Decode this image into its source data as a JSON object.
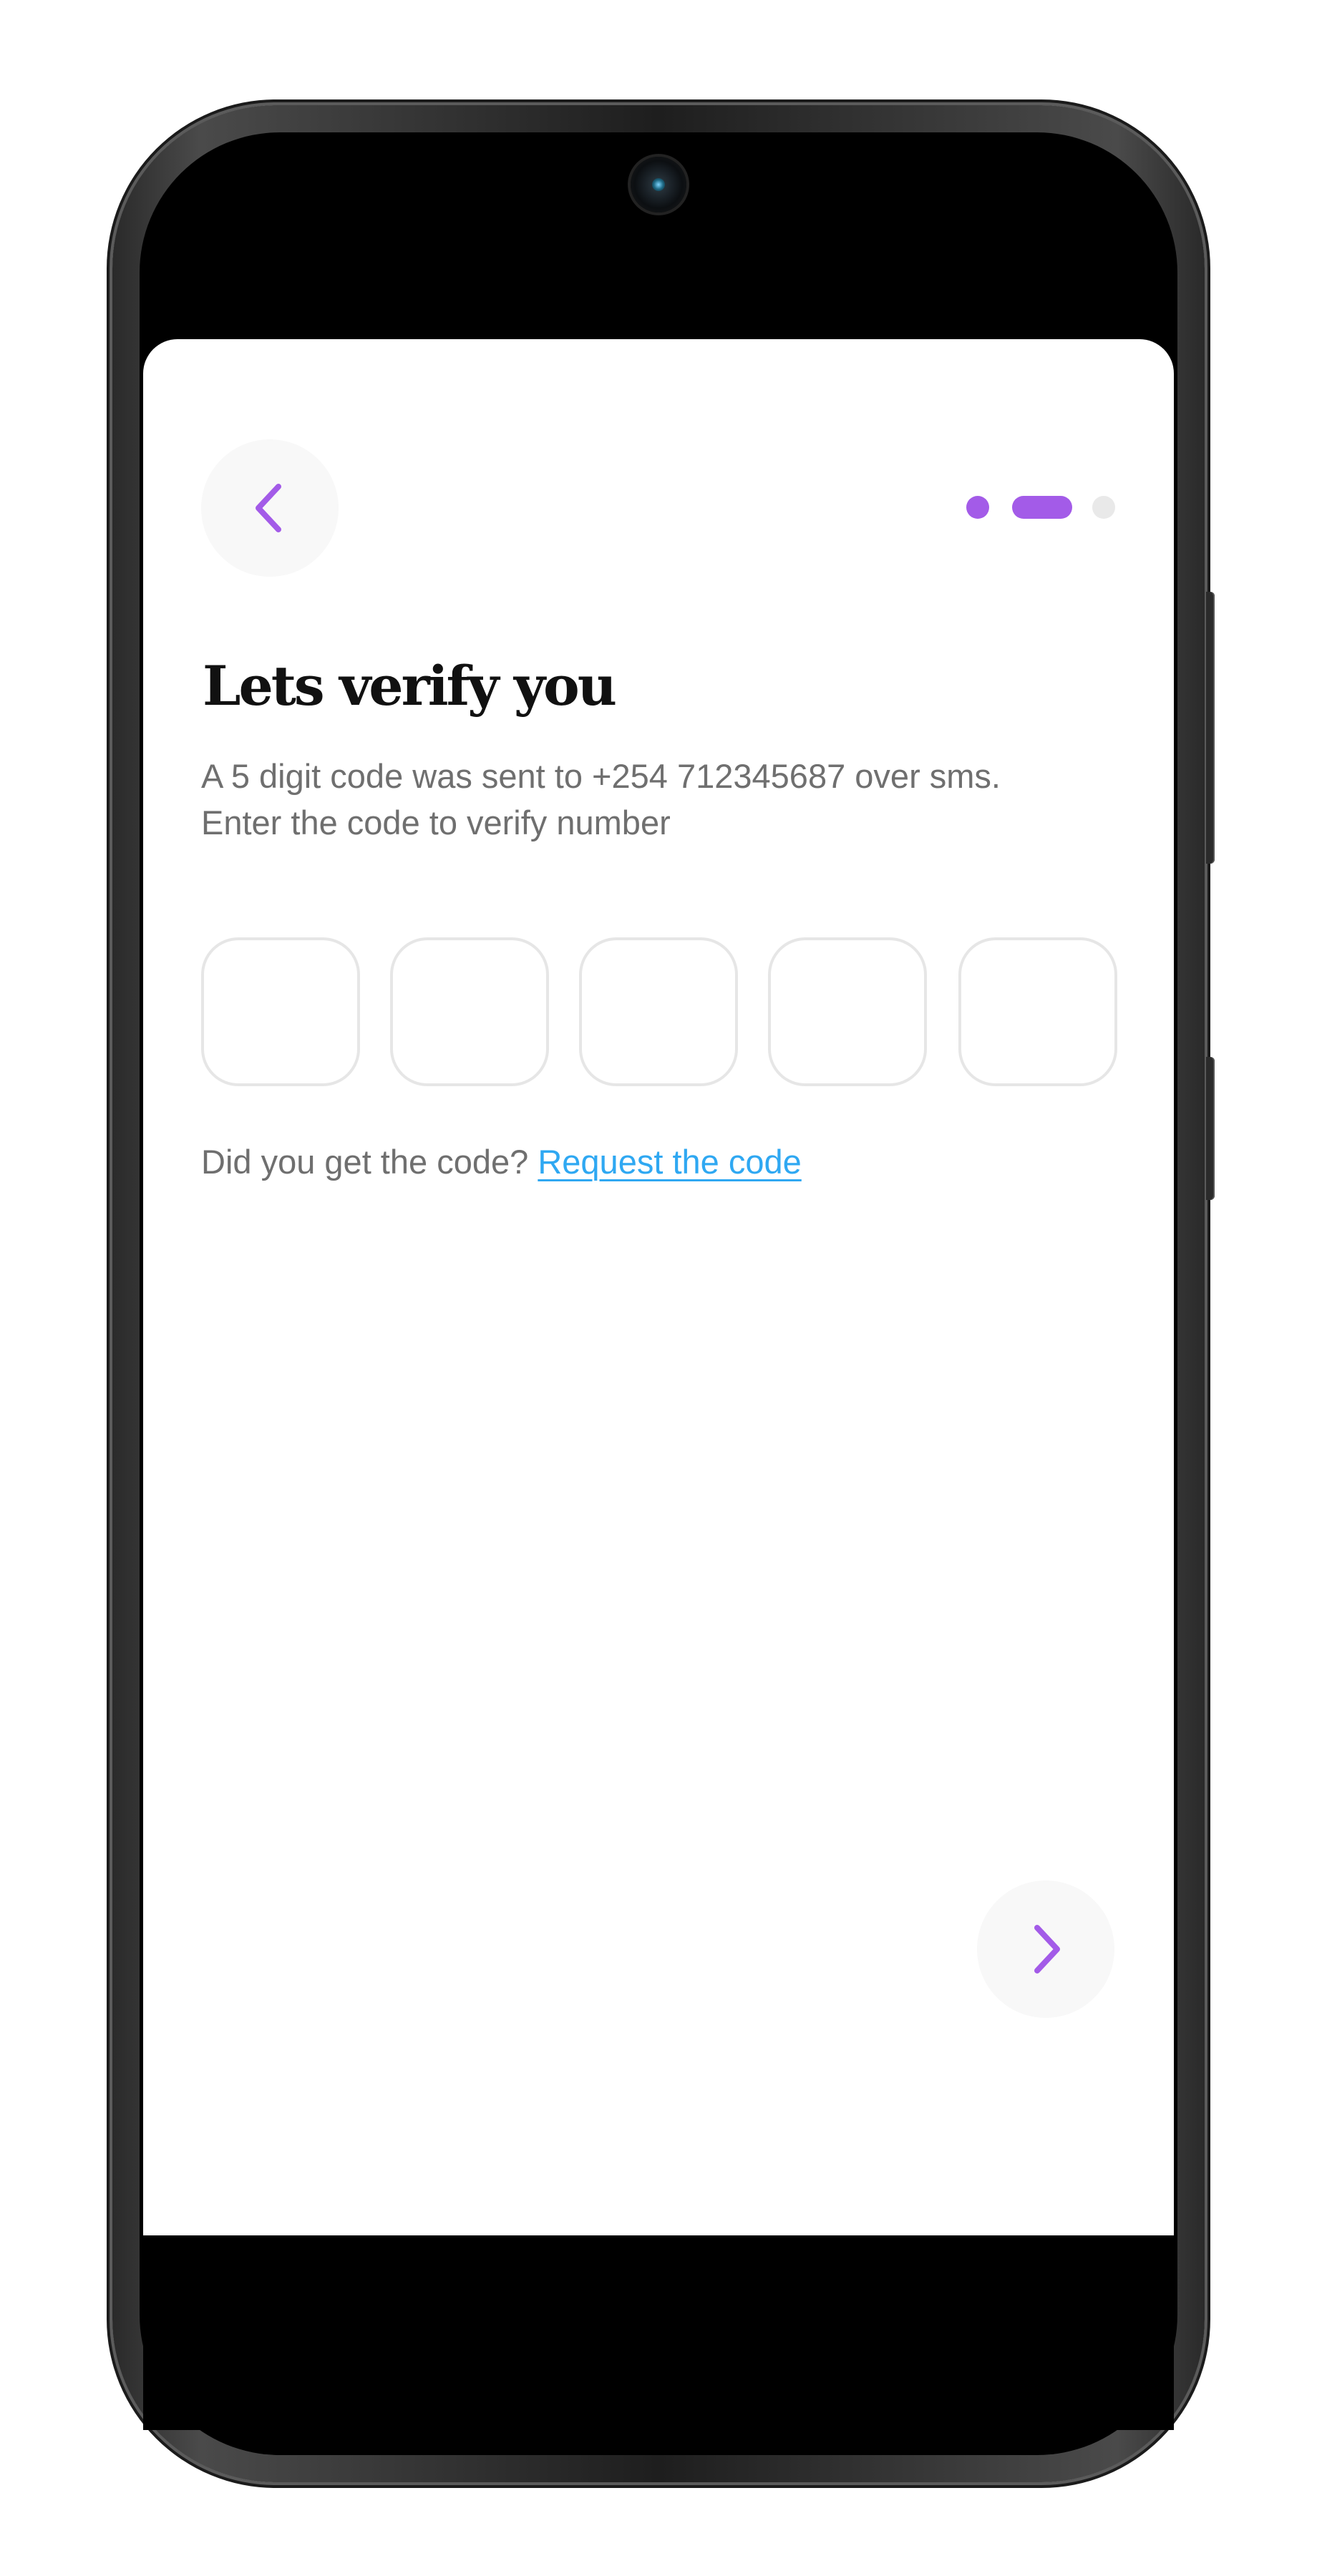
{
  "header": {
    "back_icon": "chevron-left-icon",
    "step_indicator": {
      "total_steps": 3,
      "current_step": 2,
      "active_color": "#a35be8",
      "inactive_color": "#e9e9e9"
    }
  },
  "main": {
    "title": "Lets verify you",
    "description_line_1": "A 5 digit code was sent to +254 712345687 over sms.",
    "description_line_2": "Enter the code to verify number",
    "code_inputs": [
      {
        "value": ""
      },
      {
        "value": ""
      },
      {
        "value": ""
      },
      {
        "value": ""
      },
      {
        "value": ""
      }
    ],
    "resend_prompt": "Did you get the code?",
    "resend_link": "Request the code"
  },
  "footer": {
    "next_icon": "chevron-right-icon"
  },
  "colors": {
    "accent": "#a35be8",
    "link": "#2fa8f2",
    "text_muted": "#6f6f6f",
    "title": "#111111",
    "input_border": "#e6e6e6",
    "button_background": "#f8f8f8"
  }
}
